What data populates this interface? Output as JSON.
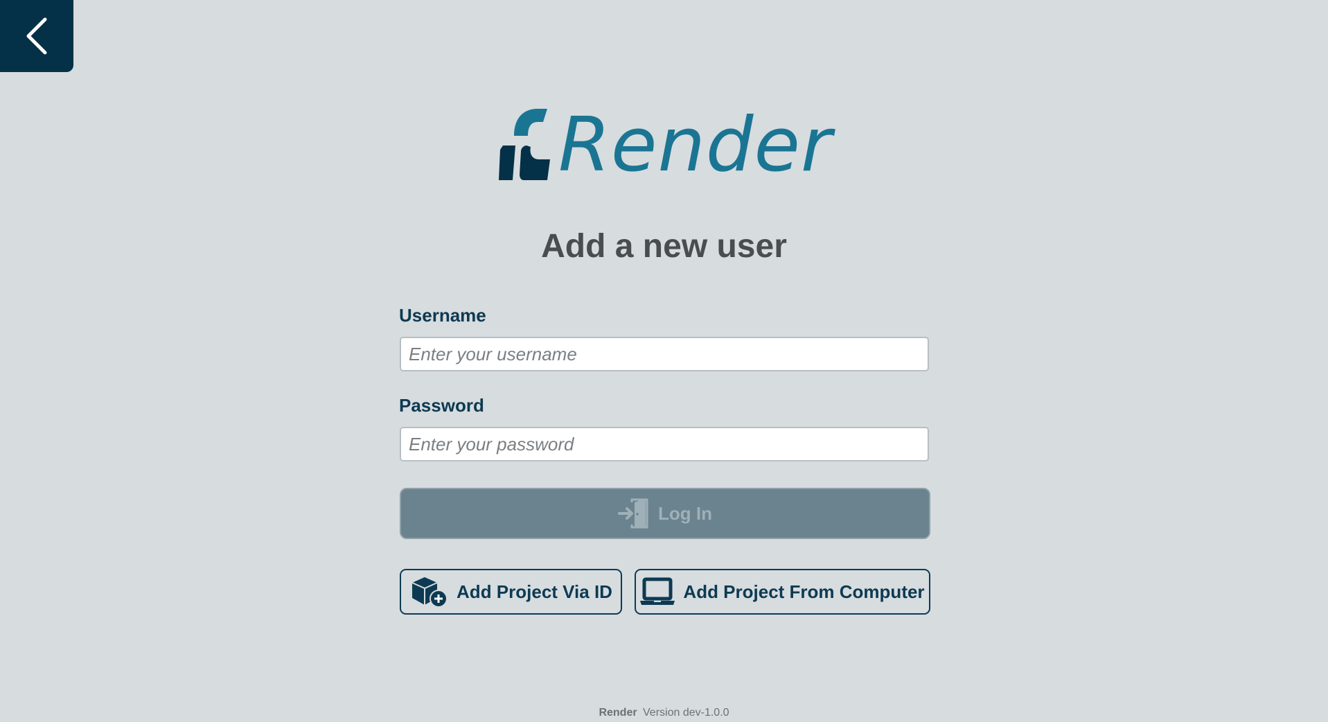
{
  "back_button": {
    "icon": "chevron-left-icon"
  },
  "logo": {
    "text": "Render",
    "colors": {
      "dark": "#043147",
      "accent": "#1a7593"
    }
  },
  "title": "Add a new user",
  "form": {
    "username": {
      "label": "Username",
      "value": "",
      "placeholder": "Enter your username"
    },
    "password": {
      "label": "Password",
      "value": "",
      "placeholder": "Enter your password"
    },
    "login": {
      "label": "Log In",
      "icon": "sign-in-door-icon",
      "disabled": true
    }
  },
  "actions": {
    "add_via_id": {
      "label": "Add Project Via ID",
      "icon": "box-plus-icon"
    },
    "add_from_computer": {
      "label": "Add Project From Computer",
      "icon": "laptop-icon"
    }
  },
  "footer": {
    "app_name": "Render",
    "version": "Version dev-1.0.0"
  },
  "colors": {
    "background": "#d7dcdf",
    "primary_dark": "#043147",
    "label": "#0d3a52",
    "disabled_button": "#6a838e"
  }
}
